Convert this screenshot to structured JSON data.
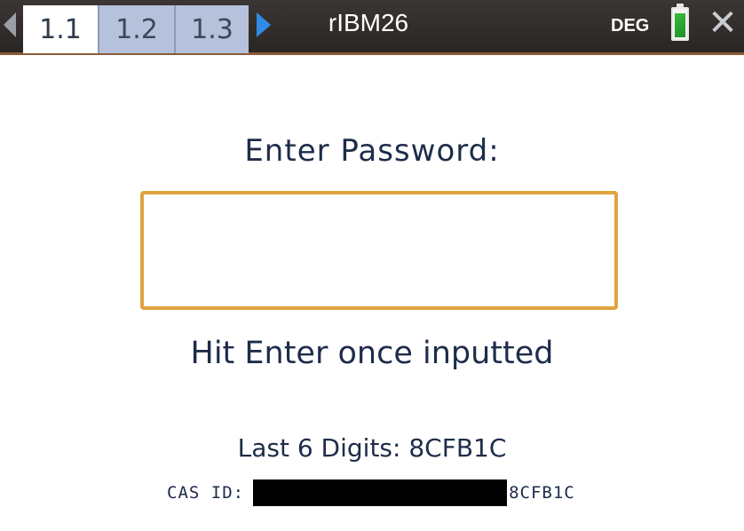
{
  "header": {
    "tabs": [
      {
        "label": "1.1",
        "active": true
      },
      {
        "label": "1.2",
        "active": false
      },
      {
        "label": "1.3",
        "active": false
      }
    ],
    "document_title": "rIBM26",
    "angle_mode": "DEG",
    "battery_level_percent": 90,
    "icons": {
      "prev": "left-arrow-icon",
      "next": "right-arrow-icon",
      "battery": "battery-icon",
      "close": "close-icon"
    }
  },
  "main": {
    "prompt": "Enter Password:",
    "password_value": "",
    "instruction": "Hit Enter once inputted",
    "last_digits_label": "Last 6 Digits: 8CFB1C",
    "cas_id_label": "CAS ID:",
    "cas_id_suffix": "8CFB1C"
  },
  "colors": {
    "input_border": "#e0a340",
    "text": "#1e2c4a",
    "tab_inactive": "#b6c2db",
    "next_arrow": "#2f8ce6"
  }
}
